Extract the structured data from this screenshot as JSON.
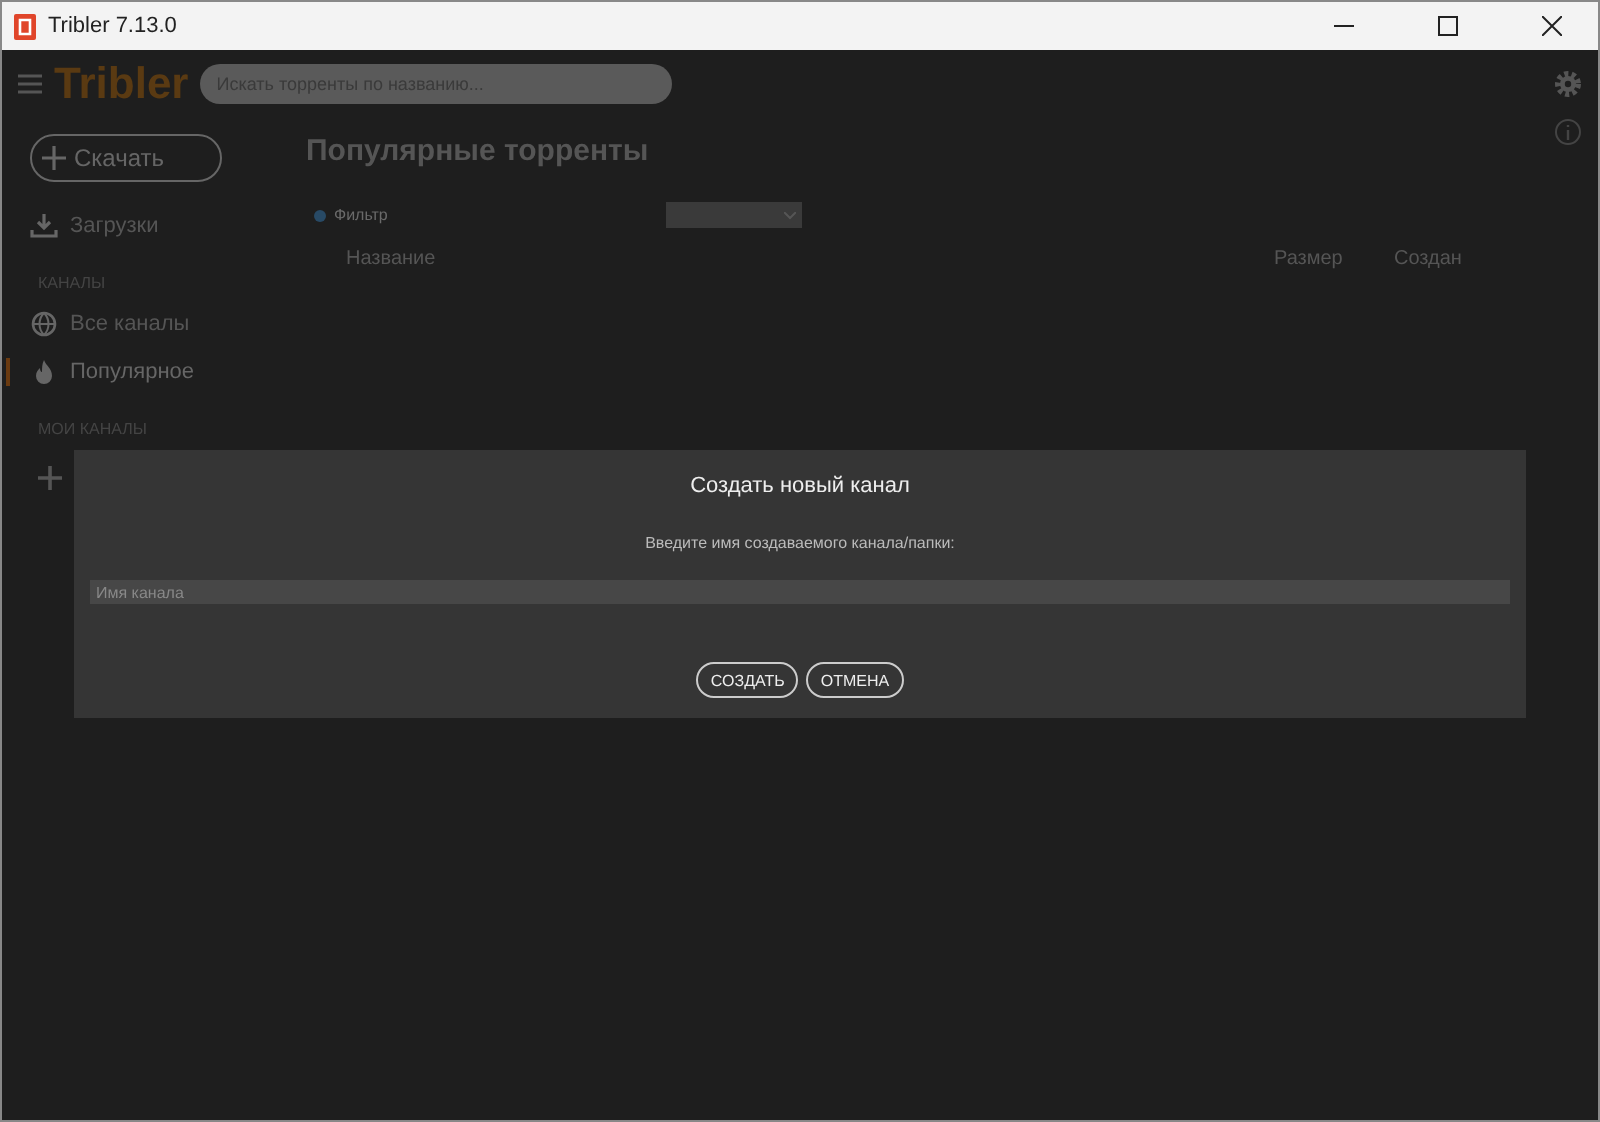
{
  "window": {
    "title": "Tribler 7.13.0"
  },
  "header": {
    "logo": "Tribler",
    "search": {
      "placeholder": "Искать торренты по названию..."
    }
  },
  "sidebar": {
    "download_button": "Скачать",
    "items": [
      {
        "kind": "download",
        "label": "Загрузки",
        "selected": false
      }
    ],
    "sections": [
      {
        "title": "КАНАЛЫ",
        "items": [
          {
            "kind": "globe",
            "label": "Все каналы",
            "selected": false
          },
          {
            "kind": "flame",
            "label": "Популярное",
            "selected": true
          }
        ]
      },
      {
        "title": "МОИ КАНАЛЫ"
      }
    ]
  },
  "main": {
    "title": "Популярные торренты",
    "filter": {
      "placeholder": "Фильтр"
    },
    "table": {
      "columns": [
        "Название",
        "Размер",
        "Создан"
      ]
    }
  },
  "dialog": {
    "title": "Создать новый канал",
    "prompt": "Введите имя создаваемого канала/папки:",
    "field": {
      "placeholder": "Имя канала"
    },
    "buttons": [
      "СОЗДАТЬ",
      "ОТМЕНА"
    ]
  }
}
